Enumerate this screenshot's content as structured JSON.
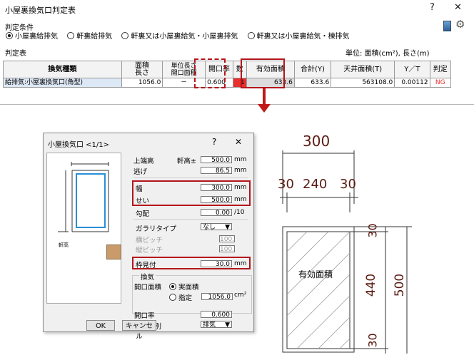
{
  "top_window": {
    "title": "小屋裏換気口判定表",
    "help_btn": "?",
    "close_btn": "✕",
    "conditions_label": "判定条件",
    "conditions": [
      {
        "label": "小屋裏給排気",
        "selected": true
      },
      {
        "label": "軒裏給排気",
        "selected": false
      },
      {
        "label": "軒裏又は小屋裏給気・小屋裏排気",
        "selected": false
      },
      {
        "label": "軒裏又は小屋裏給気・棟排気",
        "selected": false
      }
    ],
    "table_label": "判定表",
    "units_text": "単位: 面積(cm²), 長さ(m)",
    "headers": [
      "換気種類",
      "面積\n長さ",
      "単位長さ\n開口面積",
      "開口率",
      "数",
      "有効面積",
      "合計(Y)",
      "天井面積(T)",
      "Y／T",
      "判定"
    ],
    "row": [
      "給排気:小屋裏換気口(角型)",
      "1056.0",
      "－",
      "0.600",
      "1",
      "633.6",
      "633.6",
      "563108.0",
      "0.00112",
      "NG"
    ]
  },
  "dialog": {
    "title": "小屋換気口 <1/1>",
    "help_btn": "?",
    "close_btn": "✕",
    "preview_label": "軒高",
    "fields": {
      "top_end_label": "上端高",
      "top_end_sub": "軒高±",
      "top_end_value": "500.0",
      "nige_label": "逃げ",
      "nige_value": "86.5",
      "width_label": "幅",
      "width_value": "300.0",
      "height_label": "せい",
      "height_value": "500.0",
      "slope_label": "勾配",
      "slope_value": "0.00",
      "slope_unit": "/10",
      "gallery_label": "ガラリタイプ",
      "gallery_value": "なし",
      "hpitch_label": "横ピッチ",
      "hpitch_value": "100.0",
      "vpitch_label": "縦ピッチ",
      "vpitch_value": "100.0",
      "frame_label": "枠見付",
      "frame_value": "30.0",
      "mm": "mm"
    },
    "ventilation": {
      "group_label": "換気",
      "area_label": "開口面積",
      "actual_label": "実面積",
      "spec_label": "指定",
      "spec_value": "1056.0",
      "spec_unit": "cm²",
      "ratio_label": "開口率",
      "ratio_value": "0.600",
      "type_label": "換気種別",
      "type_value": "排気"
    },
    "ok_label": "OK",
    "cancel_label": "キャンセル"
  },
  "diagram": {
    "top_total": "300",
    "top_left": "30",
    "top_mid": "240",
    "top_right": "30",
    "right_top": "30",
    "right_mid": "440",
    "right_bottom": "30",
    "right_total": "500",
    "inner_label": "有効面積"
  },
  "colors": {
    "accent_red": "#b4151b",
    "ng_red": "#e8312f",
    "dim_text": "#5b1b12"
  }
}
